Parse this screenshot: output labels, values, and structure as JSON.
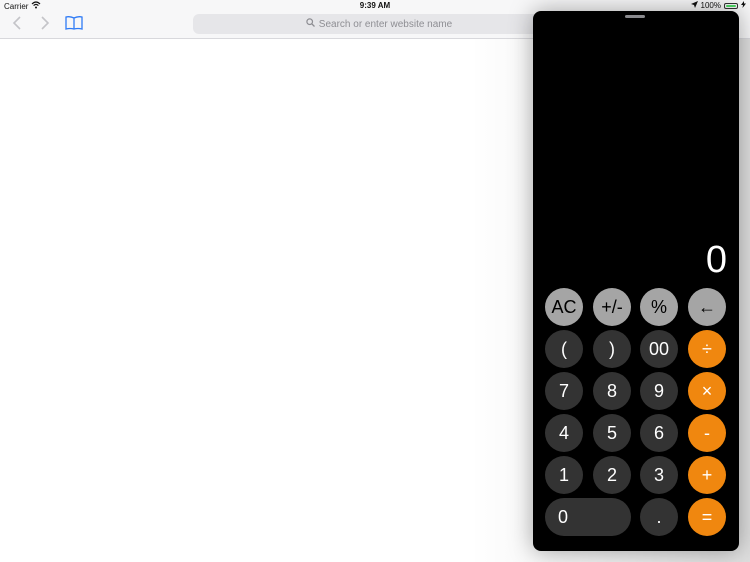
{
  "status_bar": {
    "carrier": "Carrier",
    "time": "9:39 AM",
    "battery": "100%"
  },
  "toolbar": {
    "search_placeholder": "Search or enter website name"
  },
  "calculator": {
    "display": "0",
    "keys": {
      "ac": "AC",
      "sign": "+/-",
      "percent": "%",
      "backspace": "←",
      "open_paren": "(",
      "close_paren": ")",
      "double_zero": "00",
      "divide": "÷",
      "seven": "7",
      "eight": "8",
      "nine": "9",
      "multiply": "×",
      "four": "4",
      "five": "5",
      "six": "6",
      "minus": "-",
      "one": "1",
      "two": "2",
      "three": "3",
      "plus": "+",
      "zero": "0",
      "decimal": ".",
      "equals": "="
    },
    "colors": {
      "function_key": "#a5a5a5",
      "digit_key": "#333333",
      "operator_key": "#f0870f"
    }
  },
  "icons": [
    "wifi-icon",
    "location-arrow-icon",
    "battery-icon",
    "charging-icon",
    "back-icon",
    "forward-icon",
    "bookmarks-icon",
    "search-icon"
  ]
}
